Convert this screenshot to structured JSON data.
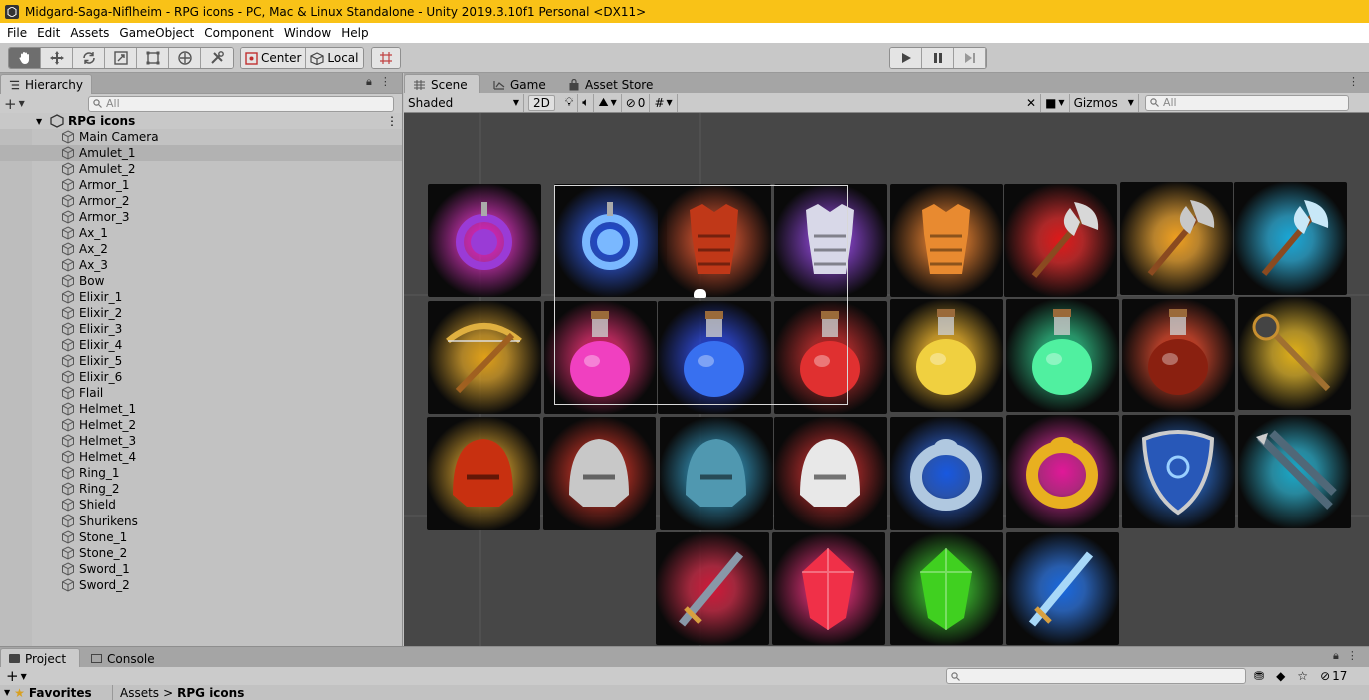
{
  "window": {
    "title": "Midgard-Saga-Niflheim - RPG icons - PC, Mac & Linux Standalone - Unity 2019.3.10f1 Personal <DX11>"
  },
  "menu": [
    "File",
    "Edit",
    "Assets",
    "GameObject",
    "Component",
    "Window",
    "Help"
  ],
  "toolbar": {
    "pivot_label": "Center",
    "space_label": "Local"
  },
  "hierarchy": {
    "tab_label": "Hierarchy",
    "search_placeholder": "All",
    "scene_name": "RPG icons",
    "items": [
      "Main Camera",
      "Amulet_1",
      "Amulet_2",
      "Armor_1",
      "Armor_2",
      "Armor_3",
      "Ax_1",
      "Ax_2",
      "Ax_3",
      "Bow",
      "Elixir_1",
      "Elixir_2",
      "Elixir_3",
      "Elixir_4",
      "Elixir_5",
      "Elixir_6",
      "Flail",
      "Helmet_1",
      "Helmet_2",
      "Helmet_3",
      "Helmet_4",
      "Ring_1",
      "Ring_2",
      "Shield",
      "Shurikens",
      "Stone_1",
      "Stone_2",
      "Sword_1",
      "Sword_2"
    ],
    "selected_index": 1
  },
  "scene": {
    "tabs": [
      "Scene",
      "Game",
      "Asset Store"
    ],
    "draw_mode": "Shaded",
    "mode_2d": "2D",
    "hidden_count": "0",
    "gizmos_label": "Gizmos",
    "search_placeholder": "All"
  },
  "icons": [
    {
      "name": "amulet-1",
      "glow": "#e020c0",
      "item": "#9a3bd6"
    },
    {
      "name": "amulet-2",
      "glow": "#1848e0",
      "item": "#7ab8ff"
    },
    {
      "name": "armor-1",
      "glow": "#d04018",
      "item": "#c03818"
    },
    {
      "name": "armor-2",
      "glow": "#8030d0",
      "item": "#d8d8e8"
    },
    {
      "name": "armor-3",
      "glow": "#e07018",
      "item": "#e88a30"
    },
    {
      "name": "ax-1",
      "glow": "#e01818",
      "item": "#d8d8d8"
    },
    {
      "name": "ax-2",
      "glow": "#f0a020",
      "item": "#c8c8c8"
    },
    {
      "name": "ax-3",
      "glow": "#18a8d8",
      "item": "#c8e8f8"
    },
    {
      "name": "bow",
      "glow": "#e0a018",
      "item": "#e0b040"
    },
    {
      "name": "elixir-1",
      "glow": "#e01860",
      "item": "#f040c0"
    },
    {
      "name": "elixir-2",
      "glow": "#1838e0",
      "item": "#3870f0"
    },
    {
      "name": "elixir-3",
      "glow": "#c01818",
      "item": "#e03030"
    },
    {
      "name": "elixir-4",
      "glow": "#f0b018",
      "item": "#f0d040"
    },
    {
      "name": "elixir-5",
      "glow": "#18b878",
      "item": "#50f0a0"
    },
    {
      "name": "elixir-6",
      "glow": "#e03818",
      "item": "#8a2010"
    },
    {
      "name": "flail",
      "glow": "#e0b018",
      "item": "#c89030"
    },
    {
      "name": "helmet-1",
      "glow": "#e0a018",
      "item": "#c83010"
    },
    {
      "name": "helmet-2",
      "glow": "#d82010",
      "item": "#c8c8c8"
    },
    {
      "name": "helmet-3",
      "glow": "#2098c8",
      "item": "#5098b0"
    },
    {
      "name": "helmet-4",
      "glow": "#c81818",
      "item": "#e8e8e8"
    },
    {
      "name": "ring-1",
      "glow": "#1858e0",
      "item": "#b0c8e0"
    },
    {
      "name": "ring-2",
      "glow": "#e01898",
      "item": "#e8b020"
    },
    {
      "name": "shield",
      "glow": "#1868e0",
      "item": "#2858b8"
    },
    {
      "name": "shurikens",
      "glow": "#18a8c8",
      "item": "#506878"
    },
    {
      "name": "sword-1",
      "glow": "#d01838",
      "item": "#8898a8"
    },
    {
      "name": "stone-1",
      "glow": "#e01868",
      "item": "#f03048"
    },
    {
      "name": "stone-2",
      "glow": "#28c018",
      "item": "#40d020"
    },
    {
      "name": "sword-2",
      "glow": "#1868e0",
      "item": "#a8d8f8"
    }
  ],
  "bottom": {
    "tabs": [
      "Project",
      "Console"
    ],
    "favorites_label": "Favorites",
    "breadcrumb": [
      "Assets",
      "RPG icons"
    ],
    "hidden_count": "17"
  }
}
